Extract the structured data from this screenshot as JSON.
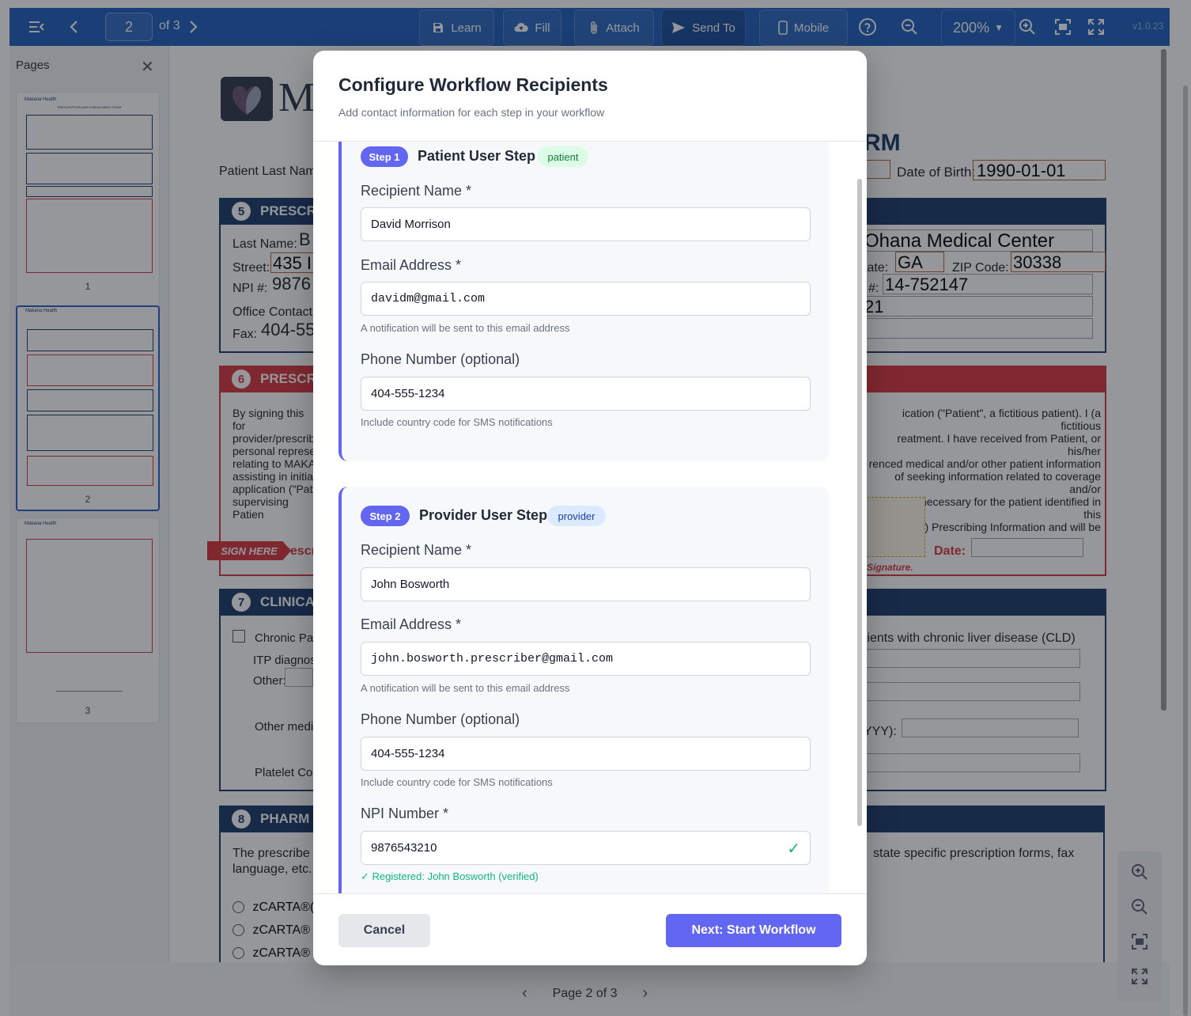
{
  "toolbar": {
    "page_current": "2",
    "page_of": "of 3",
    "learn": "Learn",
    "fill": "Fill",
    "attach": "Attach",
    "send_to": "Send To",
    "mobile": "Mobile",
    "zoom": "200%",
    "version": "v1.0.23",
    "color": "#1f5fbf"
  },
  "sidebar": {
    "title": "Pages",
    "pages": [
      {
        "num": "1"
      },
      {
        "num": "2"
      },
      {
        "num": "3"
      }
    ],
    "thumb_brand": "Makana Health",
    "thumb_form_title": "PRESCRIPTION AND ENROLLMENT FORM"
  },
  "document": {
    "logo_letter": "M",
    "title_tail": "RM",
    "patient_last_name_label": "Patient Last Name",
    "dob_label": "Date of Birth:",
    "dob_value": "1990-01-01",
    "section5": {
      "num": "5",
      "label": "PRESCR"
    },
    "last_name_label": "Last Name:",
    "last_name_value": "B",
    "street_label": "Street:",
    "street_value": "435 I",
    "npi_label": "NPI #:",
    "npi_value": "9876",
    "office_contact_label": "Office Contact",
    "fax_label": "Fax:",
    "fax_value": "404-55",
    "facility_value": "Ohana Medical Center",
    "state_label": "tate:",
    "state_value": "GA",
    "zip_label": "ZIP Code:",
    "zip_value": "30338",
    "tax_label": "#:",
    "tax_value": "14-752147",
    "other_value": "21",
    "section6": {
      "num": "6",
      "label": "PRESCR"
    },
    "consent_left": [
      "By signing this for",
      "provider/prescribe",
      "personal represe",
      "relating to MAKA",
      "assisting in initiati",
      "application (\"Pati",
      "supervising Patien"
    ],
    "consent_right": [
      "ication (\"Patient\", a fictitious patient). I (a fictitious",
      "reatment. I have received from Patient, or his/her",
      "renced medical and/or other patient information",
      "of seeking information related to coverage and/or",
      "edically necessary for the patient identified in this",
      "company) Prescribing Information and will be"
    ],
    "sign_here": "SIGN HERE",
    "prescriber_sig": "Prescr",
    "date_label": "Date:",
    "signature_note": "Signature.",
    "section7": {
      "num": "7",
      "label": "CLINICA"
    },
    "chronic": "Chronic Par",
    "itp": "ITP diagnosis",
    "other": "Other:",
    "cld": "tients with chronic liver disease (CLD)",
    "other_medica": "Other medica",
    "yyyy": "YYY):",
    "platelet": "Platelet Cour",
    "section8": {
      "num": "8",
      "label": "PHARM"
    },
    "prescribe_left": "The prescribe",
    "language": "language, etc.",
    "prescribe_right": "state specific prescription forms, fax",
    "zcarta": [
      "zCARTA®(z",
      "zCARTA® (",
      "zCARTA® (z"
    ]
  },
  "pager": {
    "text": "Page 2 of 3"
  },
  "modal": {
    "title": "Configure Workflow Recipients",
    "subtitle": "Add contact information for each step in your workflow",
    "steps": [
      {
        "pill": "Step 1",
        "title": "Patient User Step",
        "role": "patient",
        "name_label": "Recipient Name *",
        "name_value": "David Morrison",
        "email_label": "Email Address *",
        "email_value": "davidm@gmail.com",
        "email_hint": "A notification will be sent to this email address",
        "phone_label": "Phone Number (optional)",
        "phone_value": "404-555-1234",
        "phone_hint": "Include country code for SMS notifications"
      },
      {
        "pill": "Step 2",
        "title": "Provider User Step",
        "role": "provider",
        "name_label": "Recipient Name *",
        "name_value": "John Bosworth",
        "email_label": "Email Address *",
        "email_value": "john.bosworth.prescriber@gmail.com",
        "email_hint": "A notification will be sent to this email address",
        "phone_label": "Phone Number (optional)",
        "phone_value": "404-555-1234",
        "phone_hint": "Include country code for SMS notifications",
        "npi_label": "NPI Number *",
        "npi_value": "9876543210",
        "npi_status": "✓ Registered: John Bosworth (verified)"
      }
    ],
    "cancel": "Cancel",
    "next": "Next: Start Workflow",
    "accent": "#6366f1"
  }
}
